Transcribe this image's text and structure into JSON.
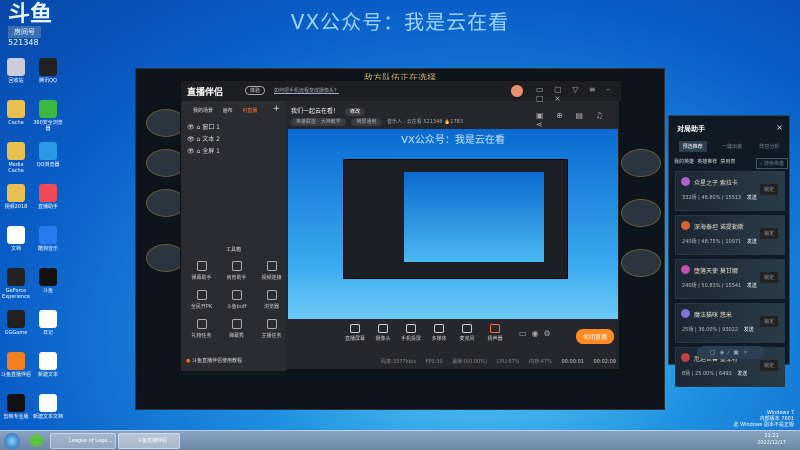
{
  "overlay_title": "VX公众号：我是云在看",
  "watermark": {
    "logo": "斗鱼",
    "room_label": "房间号",
    "room_number": "521348"
  },
  "desktop_icons": [
    "回收站",
    "腾讯QQ",
    "Cache",
    "360安全浏览器",
    "Media Cache",
    "QQ浏览器",
    "视频2018",
    "直播助手",
    "文档",
    "酷狗音乐",
    "GeForce Experience",
    "斗鱼",
    "GGGame",
    "日记",
    "斗鱼直播伴侣",
    "新建文本",
    "剪映专业版",
    "新建文本文档"
  ],
  "game": {
    "header": "敌方队伍正在选择"
  },
  "app": {
    "logo": "直播伴侣",
    "version_badge": "体验",
    "tip": "如何把手机远程变成摄像头？",
    "left_tabs": [
      "我的场景",
      "画布",
      "可直播"
    ],
    "add": "+",
    "scenes": [
      "窗口 1",
      "文本 2",
      "全屏 1"
    ],
    "toolbox_title": "工具箱",
    "tools": [
      "弹幕助手",
      "房管助手",
      "视频连接",
      "全民开PK",
      "斗鱼buff",
      "浏览器",
      "礼物任务",
      "弹幕秀",
      "主播任务"
    ],
    "tutorial": "斗鱼直播伴侣使用教程",
    "stream_title": "我们一起云在看！",
    "edit": "修改",
    "category": "英雄联盟 · 大神教学",
    "layout": "横屏通用",
    "streamer": "音乐人 · 云在看",
    "room": "521348",
    "heat": "1783",
    "preview_title": "VX公众号：我是云在看",
    "controls": [
      "直播屏幕",
      "摄像头",
      "手机投屏",
      "多媒体",
      "麦克风",
      "扬声器"
    ],
    "stop_button": "关闭直播",
    "status": {
      "bitrate": "码率:3377kb/s",
      "fps": "FPS:30",
      "dropped": "丢帧:0(0.00%)",
      "cpu": "CPU:67%",
      "mem": "内存:47%",
      "live_time": "00:00:01",
      "total_time": "00:02:09"
    }
  },
  "panel": {
    "title": "对局助手",
    "close": "×",
    "tabs": [
      "预选推荐",
      "一键出装",
      "阵容分析"
    ],
    "subtabs": [
      "我的英雄",
      "英雄推荐",
      "禁用表"
    ],
    "search_placeholder": "搜索英雄",
    "champions": [
      {
        "name": "众星之子 索拉卡",
        "stats": "332场 | 48.80% | 15513",
        "send": "发送",
        "lock": "锁定"
      },
      {
        "name": "深海泰坦 诺提勒斯",
        "stats": "240场 | 48.75% | 10971",
        "send": "发送",
        "lock": "锁定"
      },
      {
        "name": "堕落天使 莫甘娜",
        "stats": "240场 | 50.83% | 15541",
        "send": "发送",
        "lock": "锁定"
      },
      {
        "name": "魔法猫咪 悠米",
        "stats": "25场 | 36.00% | 93022",
        "send": "发送",
        "lock": "锁定"
      },
      {
        "name": "厄运巨兽 墨菲特",
        "stats": "8场 | 25.00% | 6493",
        "send": "发送",
        "lock": "锁定"
      }
    ]
  },
  "taskbar": {
    "items": [
      "League of Lege...",
      "斗鱼直播伴侣"
    ],
    "time": "21:21",
    "date": "2022/12/17"
  },
  "os_watermark": [
    "Windows 7",
    "内部版本 7601",
    "此 Windows 副本不是正版"
  ]
}
